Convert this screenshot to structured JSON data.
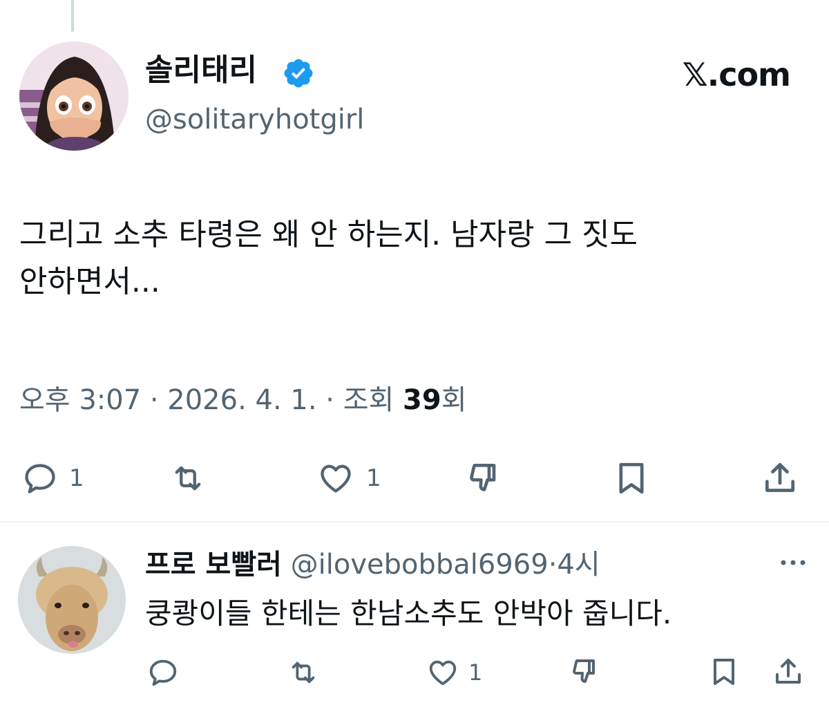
{
  "tweet": {
    "author_name": "솔리태리",
    "author_handle": "@solitaryhotgirl",
    "site_label": "𝕏.com",
    "text": "그리고 소추 타령은 왜 안 하는지. 남자랑 그 짓도\n안하면서...",
    "meta_prefix": "오후 3:07 · 2026. 4. 1. · 조회 ",
    "views_count": "39",
    "views_suffix": "회",
    "reply_count": "1",
    "like_count": "1"
  },
  "reply": {
    "author_name": "프로 보빨러",
    "author_handle": "@ilovebobbal6969",
    "separator": "·",
    "time": "4시",
    "text": "쿵쾅이들 한테는 한남소추도 안박아 줍니다.",
    "like_count": "1"
  },
  "colors": {
    "text_primary": "#0f1419",
    "text_secondary": "#536471",
    "verified_blue": "#1d9bf0",
    "divider": "#eff3f4"
  },
  "icons": [
    "verified-badge-icon",
    "reply-icon",
    "retweet-icon",
    "like-icon",
    "dislike-icon",
    "bookmark-icon",
    "share-icon",
    "more-icon"
  ]
}
